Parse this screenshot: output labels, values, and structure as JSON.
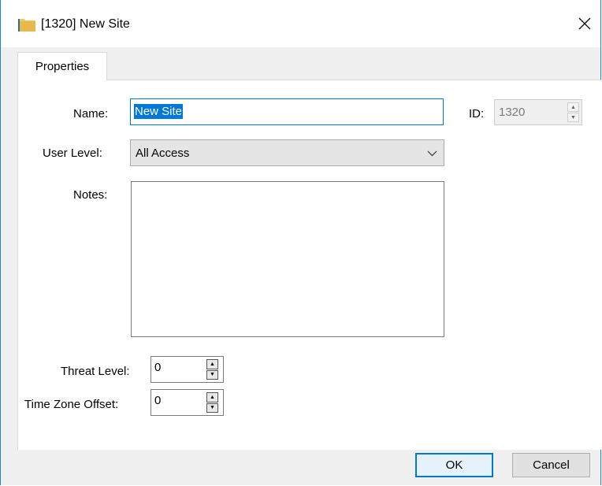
{
  "window": {
    "title": "[1320] New Site",
    "icon": "folder-icon",
    "close_icon": "close-icon"
  },
  "tabs": [
    {
      "label": "Properties",
      "active": true
    }
  ],
  "form": {
    "name": {
      "label": "Name:",
      "value": "New Site",
      "selected": true
    },
    "id": {
      "label": "ID:",
      "value": "1320",
      "disabled": true
    },
    "user_level": {
      "label": "User Level:",
      "value": "All Access"
    },
    "notes": {
      "label": "Notes:",
      "value": ""
    },
    "threat_level": {
      "label": "Threat Level:",
      "value": "0"
    },
    "time_zone_offset": {
      "label": "Time Zone Offset:",
      "value": "0"
    }
  },
  "buttons": {
    "ok": "OK",
    "cancel": "Cancel"
  },
  "colors": {
    "accent": "#0078d7",
    "window_border": "#1883d7",
    "folder": "#e8b84a"
  }
}
